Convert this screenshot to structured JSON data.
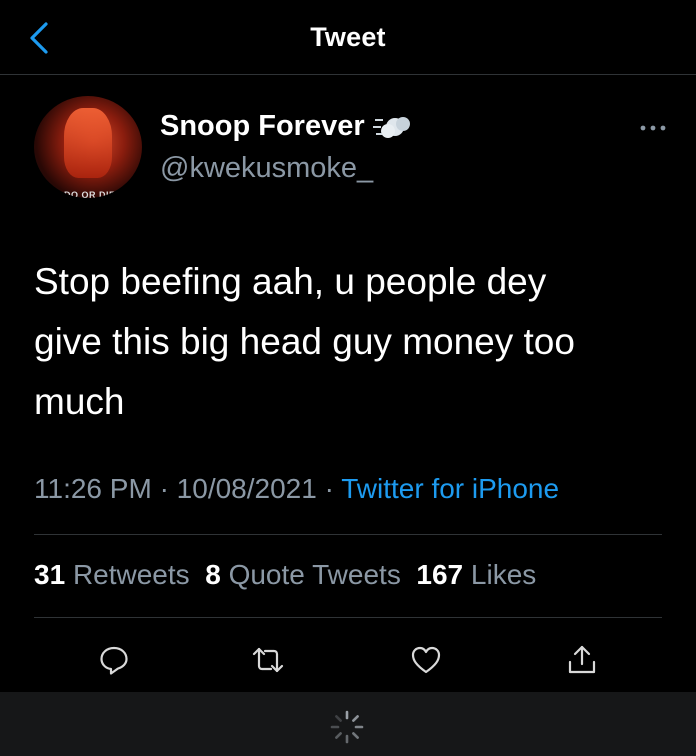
{
  "nav": {
    "title": "Tweet",
    "back_icon": "chevron-left-icon"
  },
  "author": {
    "display_name": "Snoop Forever",
    "emoji_icon": "dash-cloud-icon",
    "handle": "@kwekusmoke_",
    "avatar_caption": "DO OR DIE",
    "more_icon": "more-horizontal-icon"
  },
  "tweet": {
    "text": "Stop beefing aah, u people dey\ngive this big head guy money too\nmuch",
    "time": "11:26 PM",
    "date": "10/08/2021",
    "source": "Twitter for iPhone"
  },
  "stats": {
    "retweets_count": "31",
    "retweets_label": "Retweets",
    "quotes_count": "8",
    "quotes_label": "Quote Tweets",
    "likes_count": "167",
    "likes_label": "Likes"
  },
  "actions": [
    "reply-icon",
    "retweet-icon",
    "like-icon",
    "share-icon"
  ],
  "colors": {
    "background": "#000000",
    "accent": "#1d9bf0",
    "muted": "#8b98a5",
    "divider": "#2f3336"
  }
}
